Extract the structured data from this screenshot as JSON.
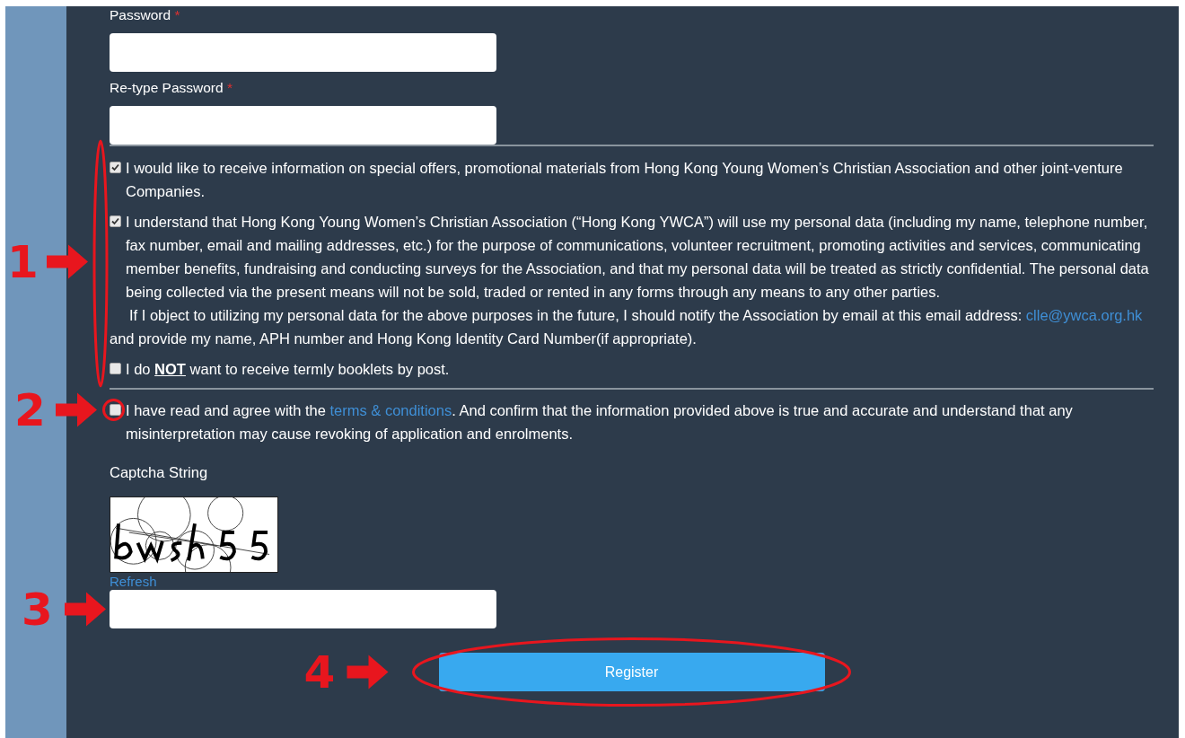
{
  "fields": [
    {
      "label": "Password",
      "required_mark": "*"
    },
    {
      "label": "Re-type Password",
      "required_mark": "*"
    }
  ],
  "consents": [
    {
      "checked": true,
      "text": "I would like to receive information on special offers, promotional materials from Hong Kong Young Women’s Christian Association and other joint-venture Companies."
    },
    {
      "checked": true,
      "text": "I understand that Hong Kong Young Women’s Christian Association (“Hong Kong YWCA”) will use my personal data (including my name, telephone number, fax number, email and mailing addresses, etc.) for the purpose of communications, volunteer recruitment, promoting activities and services, communicating member benefits, fundraising and conducting surveys for the Association, and that my personal data will be treated as strictly confidential. The personal data being collected via the present means will not be sold, traded or rented in any forms through any means to any other parties.",
      "notice": "If I object to utilizing my personal data for the above purposes in the future, I should notify the Association by email at this email address:",
      "email": "clle@ywca.org.hk",
      "notice_end": "and provide my name, APH number and Hong Kong Identity Card Number(if appropriate)."
    },
    {
      "checked": false,
      "text": "I do **NOT** want to receive termly booklets by post."
    }
  ],
  "agreement": {
    "checked": false,
    "text_before": "I have read and agree with the",
    "link": "terms & conditions",
    "text_after": ". And confirm that the information provided above is true and accurate and understand that any misinterpretation may cause revoking of application and enrolments."
  },
  "captcha": {
    "label": "Captcha String",
    "refresh": "Refresh"
  },
  "register_button": "Register",
  "annotations": [
    {
      "number": "1"
    },
    {
      "number": "2"
    },
    {
      "number": "3"
    },
    {
      "number": "4"
    }
  ]
}
